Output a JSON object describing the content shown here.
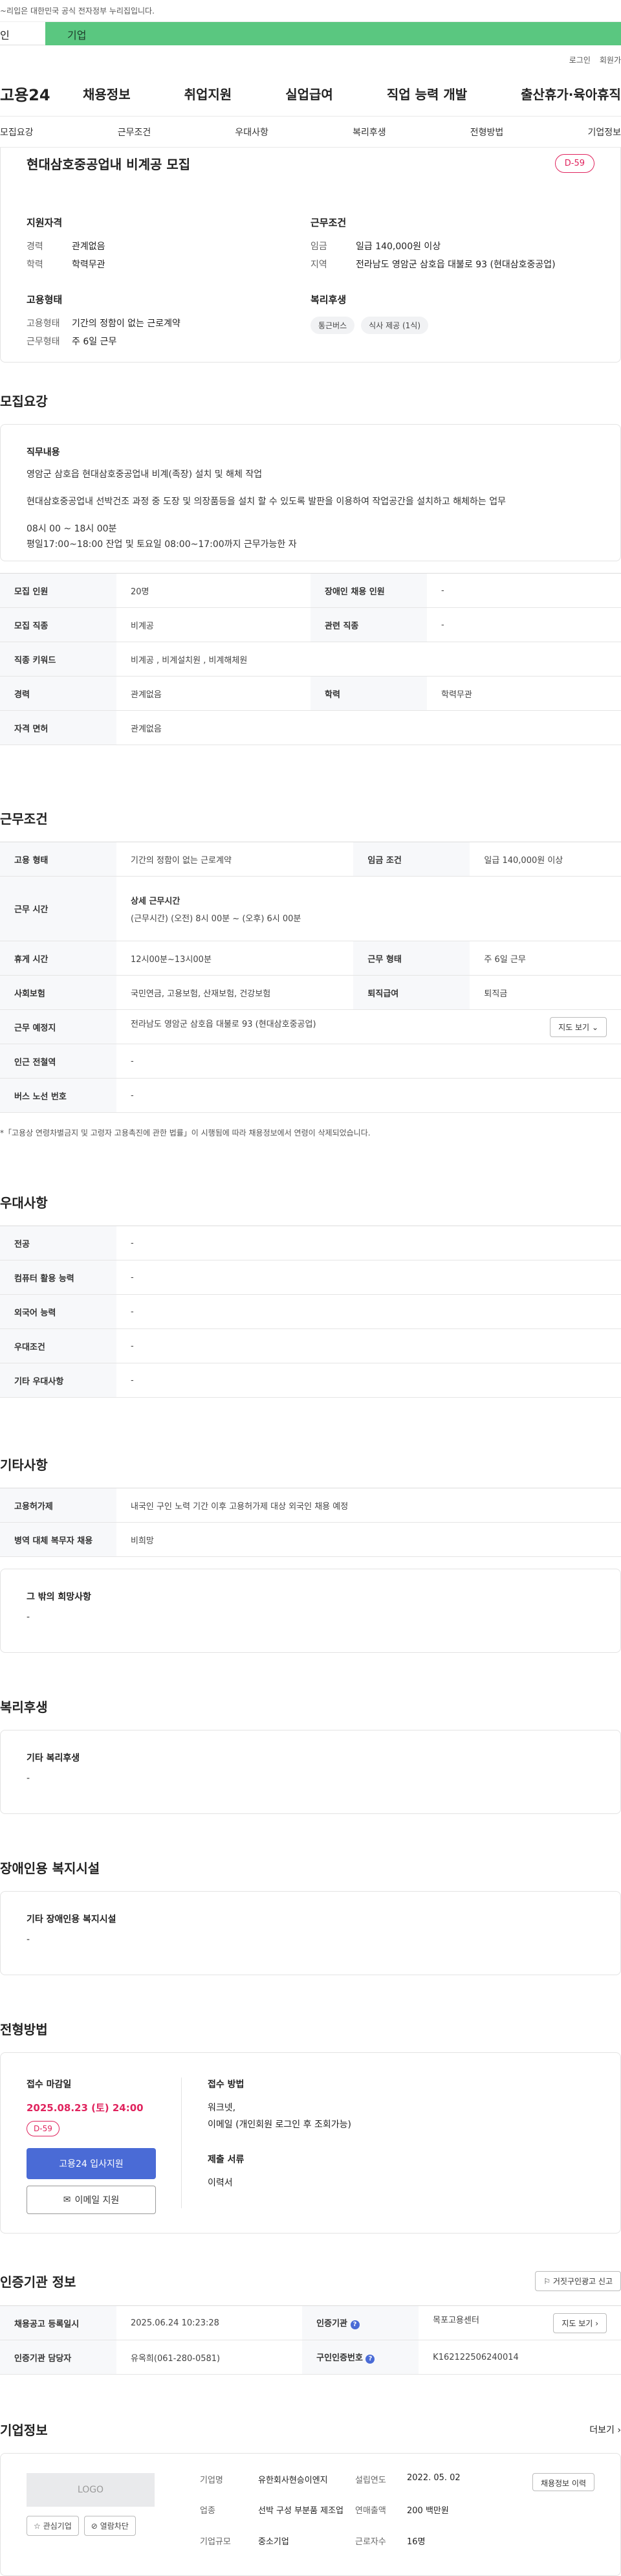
{
  "top_notice": "~리입은 대한민국 공식 전자정부 누리집입니다.",
  "audience_tabs": [
    "인",
    "기업"
  ],
  "util_links": [
    "로그인",
    "회원가"
  ],
  "logo": "고용24",
  "gnb": [
    "채용정보",
    "취업지원",
    "실업급여",
    "직업 능력 개발",
    "출산휴가·육아휴직"
  ],
  "lnb": [
    "모집요강",
    "근무조건",
    "우대사항",
    "복리후생",
    "전형방법",
    "기업정보"
  ],
  "job": {
    "title": "현대삼호중공업내 비계공 모집",
    "dday": "D-59",
    "qualification_title": "지원자격",
    "qualification": [
      {
        "k": "경력",
        "v": "관계없음"
      },
      {
        "k": "학력",
        "v": "학력무관"
      }
    ],
    "employment_title": "고용형태",
    "employment": [
      {
        "k": "고용형태",
        "v": "기간의 정함이 없는 근로계약"
      },
      {
        "k": "근무형태",
        "v": "주 6일 근무"
      }
    ],
    "conditions_title": "근무조건",
    "conditions": [
      {
        "k": "임금",
        "v": "일급 140,000원 이상"
      },
      {
        "k": "지역",
        "v": "전라남도 영암군 삼호읍 대불로 93 (현대삼호중공업)"
      }
    ],
    "welfare_title": "복리후생",
    "welfare_chips": [
      "통근버스",
      "식사 제공 (1식)"
    ]
  },
  "recruit": {
    "title": "모집요강",
    "duty_title": "직무내용",
    "duty_lines": [
      "영암군 삼호읍 현대삼호중공업내 비계(족장) 설치 및 해체 작업",
      "현대삼호중공업내 선박건조 과정 중 도장 및 의장품등을 설치 할 수 있도록 발판을 이용하여 작업공간을 설치하고 해체하는 업무",
      "08시 00 ~ 18시 00분",
      "평일17:00~18:00 잔업 및 토요일 08:00~17:00까지 근무가능한 자"
    ],
    "table": [
      {
        "k1": "모집 인원",
        "v1": "20명",
        "k2": "장애인 채용 인원",
        "v2": "-"
      },
      {
        "k1": "모집 직종",
        "v1": "비계공",
        "k2": "관련 직종",
        "v2": "-"
      },
      {
        "k1": "직종 키워드",
        "v1": "비계공 , 비계설치원 , 비계해체원"
      },
      {
        "k1": "경력",
        "v1": "관계없음",
        "k2": "학력",
        "v2": "학력무관"
      },
      {
        "k1": "자격 면허",
        "v1": "관계없음"
      }
    ]
  },
  "work": {
    "title": "근무조건",
    "type_k": "고용 형태",
    "type_v": "기간의 정함이 없는 근로계약",
    "wage_k": "임금 조건",
    "wage_v": "일급 140,000원 이상",
    "hours_k": "근무 시간",
    "hours_head": "상세 근무시간",
    "hours_v": "(근무시간) (오전) 8시 00분 ~ (오후) 6시 00분",
    "break_k": "휴게 시간",
    "break_v": "12시00분~13시00분",
    "form_k": "근무 형태",
    "form_v": "주 6일 근무",
    "ins_k": "사회보험",
    "ins_v": "국민연금, 고용보험, 산재보험, 건강보험",
    "sev_k": "퇴직급여",
    "sev_v": "퇴직금",
    "place_k": "근무 예정지",
    "place_v": "전라남도 영암군 삼호읍 대불로 93 (현대삼호중공업)",
    "map_btn": "지도 보기",
    "station_k": "인근 전철역",
    "station_v": "-",
    "bus_k": "버스 노선 번호",
    "bus_v": "-",
    "note": "*「고용상 연령차별금지 및 고령자 고용촉진에 관한 법률」이 시행됨에 따라 채용정보에서 연령이 삭제되었습니다."
  },
  "prefer": {
    "title": "우대사항",
    "rows": [
      {
        "k": "전공",
        "v": "-"
      },
      {
        "k": "컴퓨터 활용 능력",
        "v": "-"
      },
      {
        "k": "외국어 능력",
        "v": "-"
      },
      {
        "k": "우대조건",
        "v": "-"
      },
      {
        "k": "기타 우대사항",
        "v": "-"
      }
    ]
  },
  "etc": {
    "title": "기타사항",
    "rows": [
      {
        "k": "고용허가제",
        "v": "내국인 구인 노력 기간 이후 고용허가제 대상 외국인 채용 예정"
      },
      {
        "k": "병역 대체 복무자 채용",
        "v": "비희망"
      }
    ],
    "other_title": "그 밖의 희망사항",
    "other_v": "-"
  },
  "welfare": {
    "title": "복리후생",
    "box_title": "기타 복리후생",
    "box_v": "-"
  },
  "disability": {
    "title": "장애인용 복지시설",
    "box_title": "기타 장애인용 복지시설",
    "box_v": "-"
  },
  "process": {
    "title": "전형방법",
    "deadline_title": "접수 마감일",
    "deadline": "2025.08.23 (토) 24:00",
    "dday": "D-59",
    "apply_btn": "고용24 입사지원",
    "mail_btn": "이메일 지원",
    "method_title": "접수 방법",
    "method_lines": [
      "워크넷,",
      "이메일 (개인회원 로그인 후 조회가능)"
    ],
    "docs_title": "제출 서류",
    "docs_v": "이력서"
  },
  "cert": {
    "title": "인증기관 정보",
    "report_btn": "거짓구인광고 신고",
    "reg_k": "채용공고 등록일시",
    "reg_v": "2025.06.24 10:23:28",
    "org_k": "인증기관",
    "org_v": "목포고용센터",
    "map_btn": "지도 보기",
    "mgr_k": "인증기관 담당자",
    "mgr_v": "유옥희(061-280-0581)",
    "no_k": "구인인증번호",
    "no_v": "K162122506240014"
  },
  "company": {
    "title": "기업정보",
    "more": "더보기",
    "logo_ph": "LOGO",
    "fav_btn": "관심기업",
    "block_btn": "열람차단",
    "info_btn": "채용정보 이력",
    "name_k": "기업명",
    "name_v": "유한회사현승이엔지",
    "ind_k": "업종",
    "ind_v": "선박 구성 부분품 제조업",
    "size_k": "기업규모",
    "size_v": "중소기업",
    "est_k": "설립연도",
    "est_v": "2022. 05. 02",
    "sales_k": "연매출액",
    "sales_v": "200 백만원",
    "emp_k": "근로자수",
    "emp_v": "16명"
  }
}
